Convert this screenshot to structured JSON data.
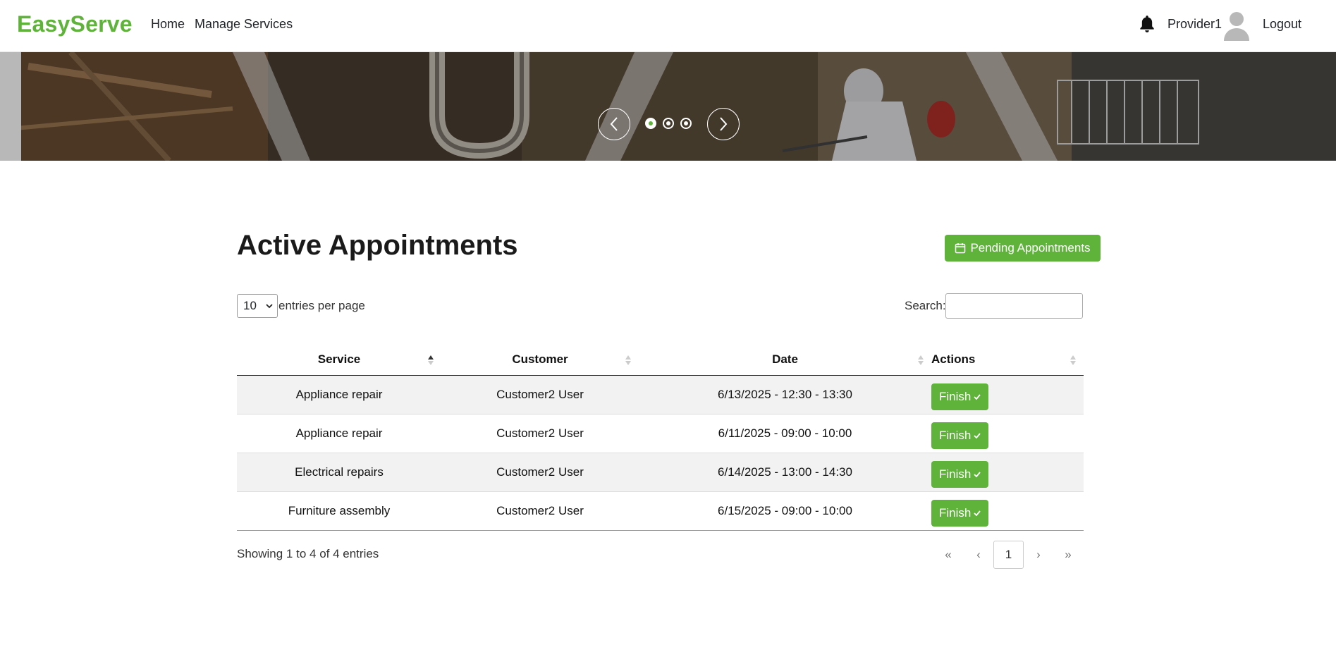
{
  "navbar": {
    "brand": "EasyServe",
    "links": [
      "Home",
      "Manage Services"
    ],
    "user_name": "Provider1",
    "logout_label": "Logout",
    "brand_color": "#5fb33a"
  },
  "hero": {
    "active_slide": 1,
    "slide_count": 3
  },
  "main": {
    "title": "Active Appointments",
    "pending_button_label": "Pending Appointments",
    "entries_per_page_value": "10",
    "entries_per_page_label": "entries per page",
    "search_label": "Search:",
    "search_value": "",
    "table": {
      "columns": [
        "Service",
        "Customer",
        "Date",
        "Actions"
      ],
      "sorted_column": "Service",
      "sort_direction": "ascending",
      "rows": [
        {
          "service": "Appliance repair",
          "customer": "Customer2 User",
          "date": "6/13/2025 - 12:30 - 13:30",
          "action": "Finish"
        },
        {
          "service": "Appliance repair",
          "customer": "Customer2 User",
          "date": "6/11/2025 - 09:00 - 10:00",
          "action": "Finish"
        },
        {
          "service": "Electrical repairs",
          "customer": "Customer2 User",
          "date": "6/14/2025 - 13:00 - 14:30",
          "action": "Finish"
        },
        {
          "service": "Furniture assembly",
          "customer": "Customer2 User",
          "date": "6/15/2025 - 09:00 - 10:00",
          "action": "Finish"
        }
      ]
    },
    "showing_text": "Showing 1 to 4 of 4 entries",
    "pagination": {
      "first": "«",
      "prev": "‹",
      "current": "1",
      "next": "›",
      "last": "»"
    }
  }
}
